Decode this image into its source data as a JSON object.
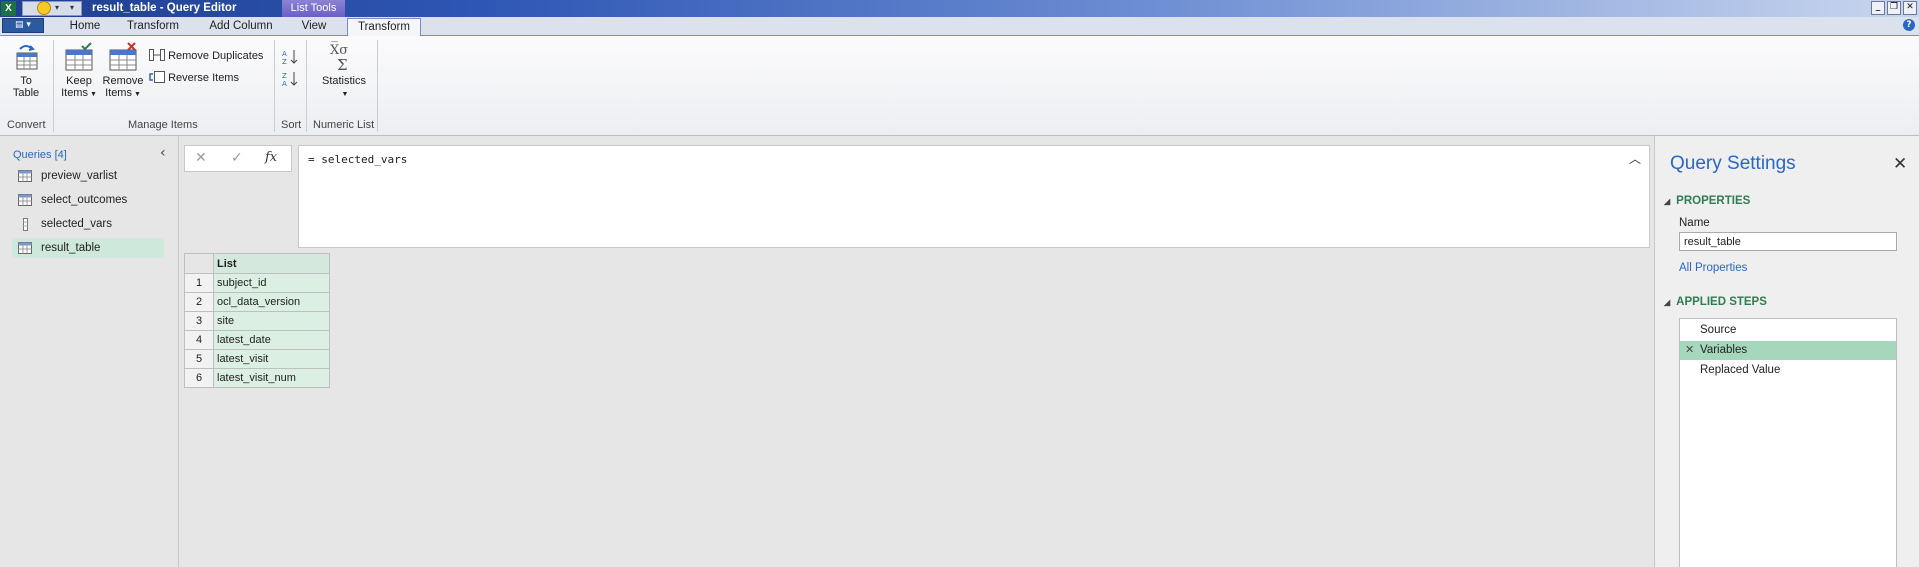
{
  "window": {
    "title": "result_table - Query Editor",
    "contextual_group": "List Tools",
    "app_icon": "X"
  },
  "ribbon": {
    "file_glyph": "▤ ▾",
    "tabs": [
      {
        "label": "Home"
      },
      {
        "label": "Transform"
      },
      {
        "label": "Add Column"
      },
      {
        "label": "View"
      },
      {
        "label": "Transform",
        "active": true
      }
    ],
    "convert": {
      "to_table_line1": "To",
      "to_table_line2": "Table",
      "group_label": "Convert"
    },
    "manage": {
      "keep_line1": "Keep",
      "keep_line2": "Items",
      "remove_line1": "Remove",
      "remove_line2": "Items",
      "remove_duplicates": "Remove Duplicates",
      "reverse_items": "Reverse Items",
      "group_label": "Manage Items"
    },
    "sort": {
      "group_label": "Sort"
    },
    "numeric": {
      "statistics": "Statistics",
      "group_label": "Numeric List"
    }
  },
  "queries": {
    "header": "Queries [4]",
    "items": [
      {
        "label": "preview_varlist",
        "icon": "table-icon"
      },
      {
        "label": "select_outcomes",
        "icon": "table-icon"
      },
      {
        "label": "selected_vars",
        "icon": "list-icon"
      },
      {
        "label": "result_table",
        "icon": "table-icon",
        "selected": true
      }
    ]
  },
  "formula": {
    "text": "= selected_vars",
    "fx": "fx"
  },
  "grid": {
    "column_header": "List",
    "rows": [
      {
        "n": "1",
        "value": "subject_id"
      },
      {
        "n": "2",
        "value": "ocl_data_version"
      },
      {
        "n": "3",
        "value": "site"
      },
      {
        "n": "4",
        "value": "latest_date"
      },
      {
        "n": "5",
        "value": "latest_visit"
      },
      {
        "n": "6",
        "value": "latest_visit_num"
      }
    ]
  },
  "settings": {
    "title": "Query Settings",
    "properties_header": "PROPERTIES",
    "name_label": "Name",
    "name_value": "result_table",
    "all_properties": "All Properties",
    "applied_steps_header": "APPLIED STEPS",
    "steps": [
      {
        "label": "Source"
      },
      {
        "label": "Variables",
        "selected": true
      },
      {
        "label": "Replaced Value"
      }
    ]
  },
  "colors": {
    "accent": "#2a66c4",
    "section_green": "#2e7d50",
    "selected_step": "#a5d7bd",
    "grid_cell": "#dbefe2"
  }
}
